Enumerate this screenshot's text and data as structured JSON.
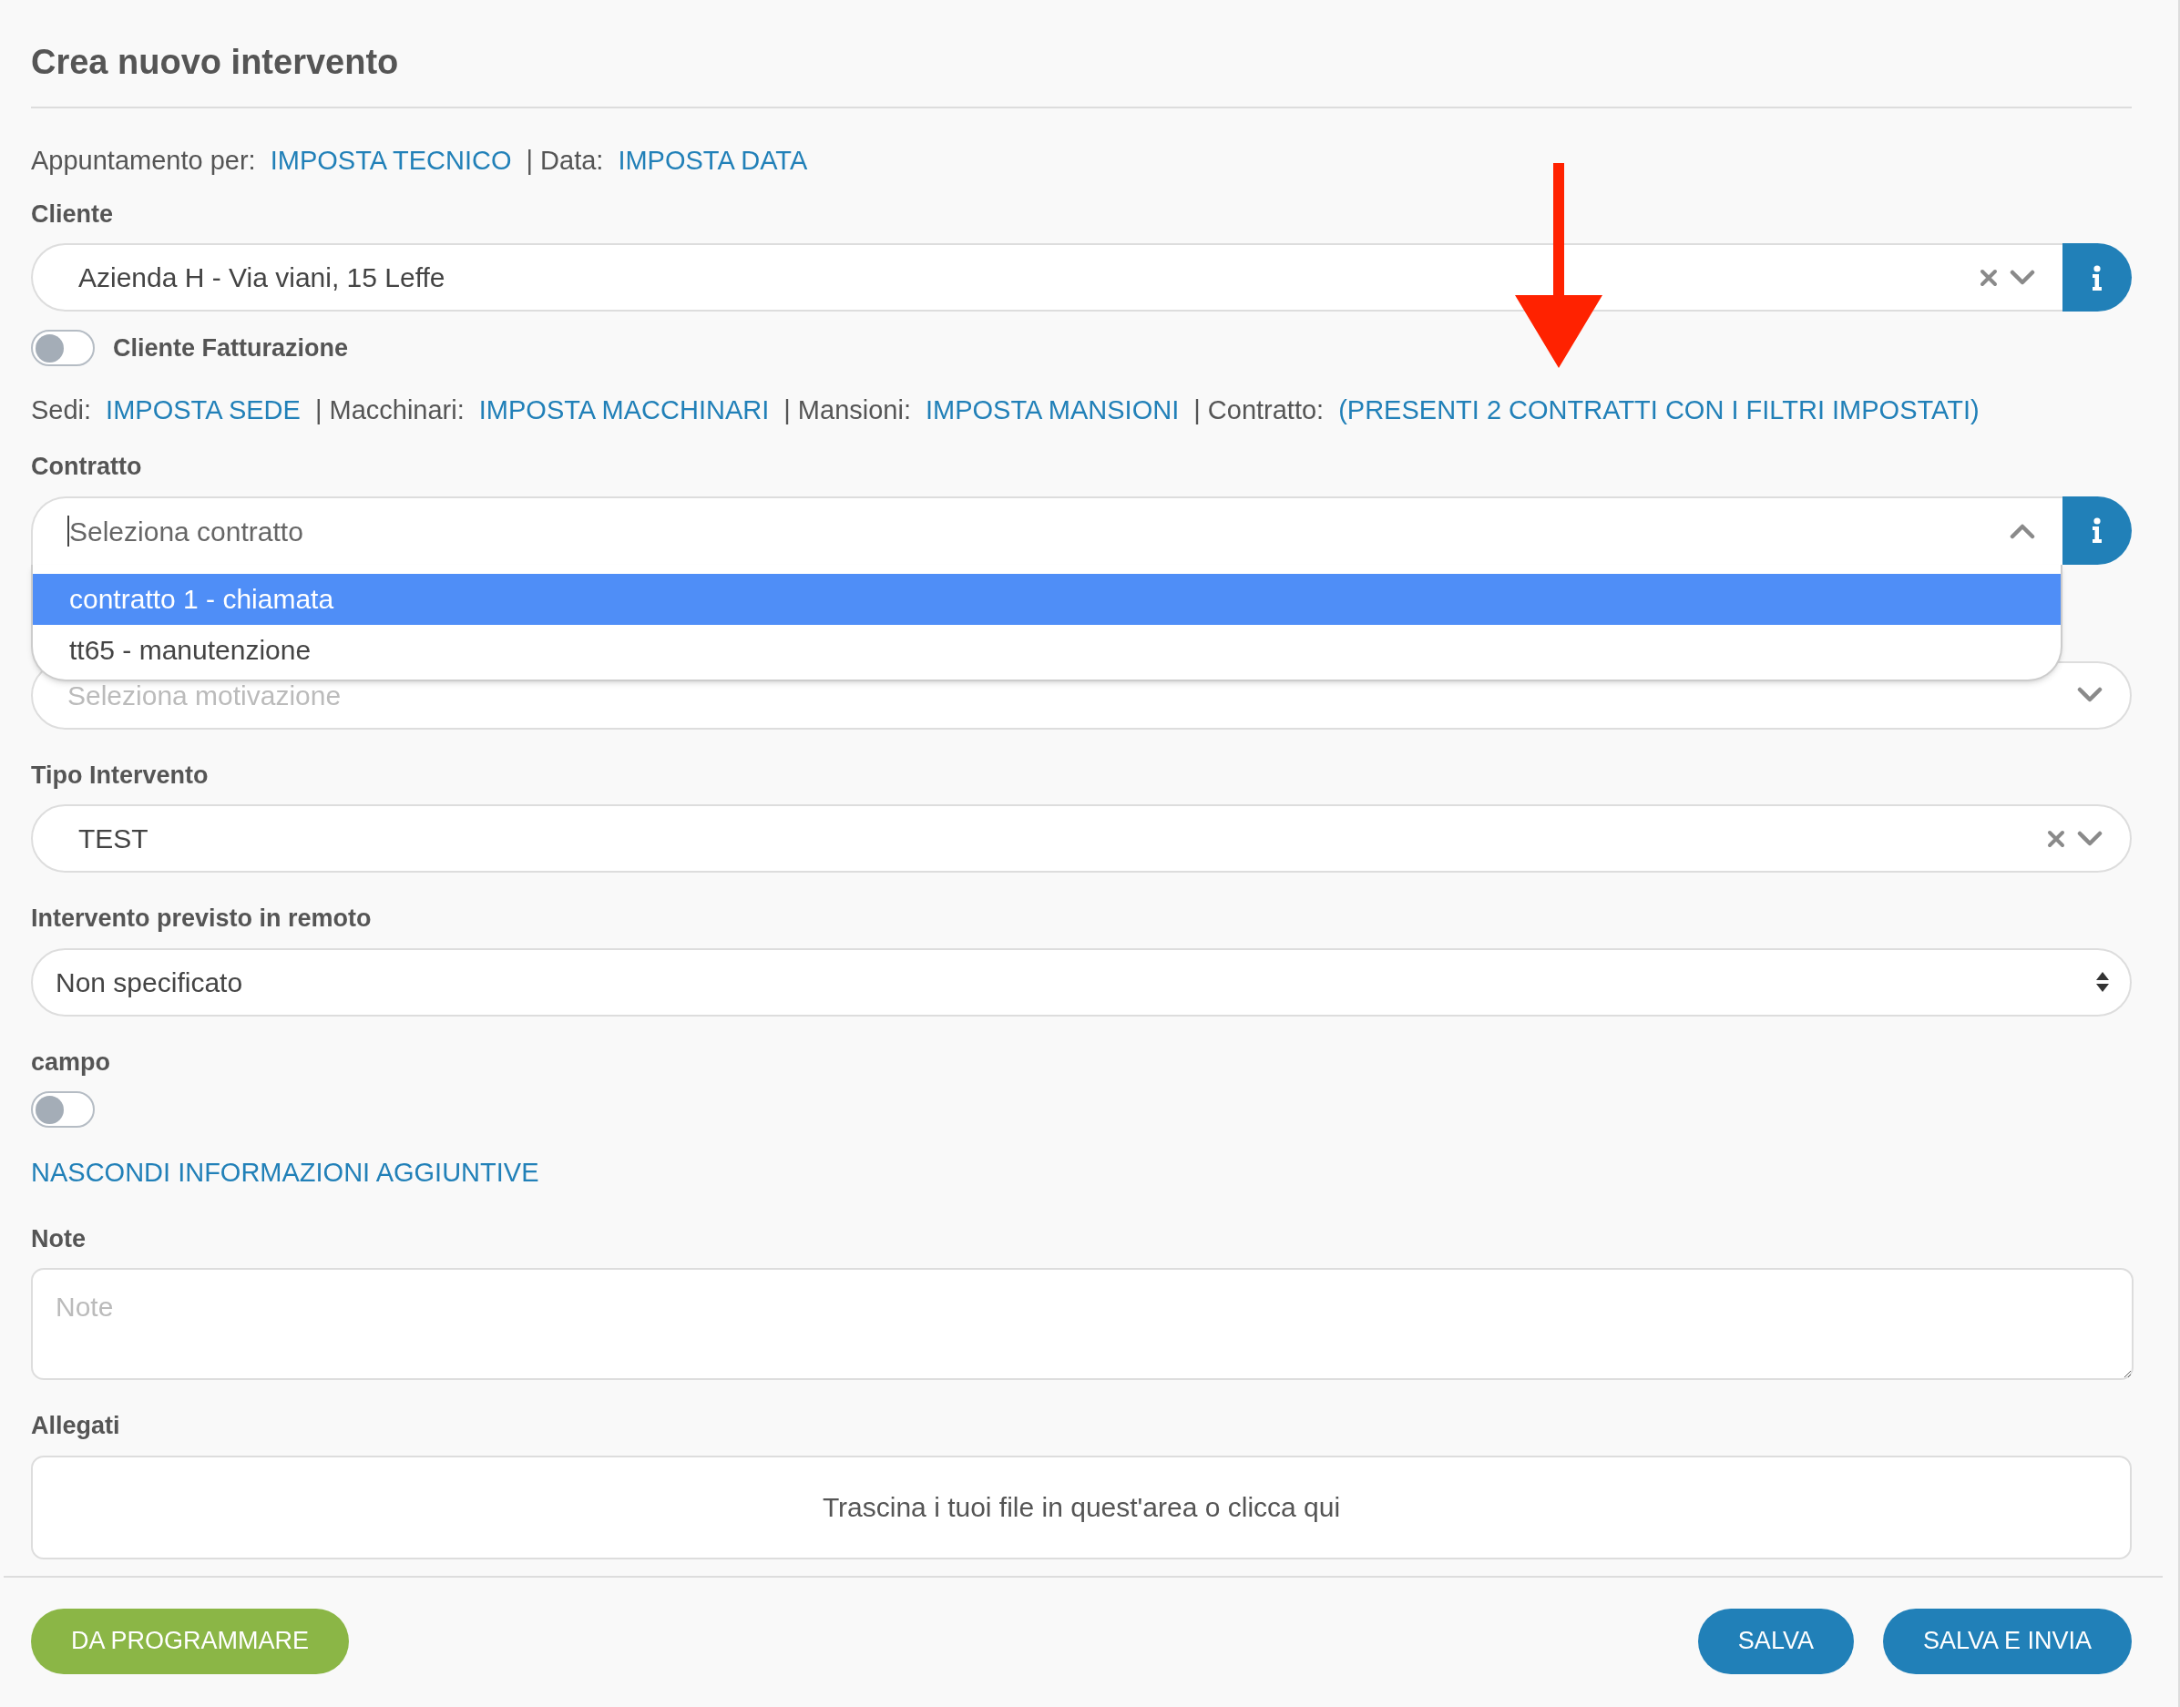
{
  "title": "Crea nuovo intervento",
  "info_row": [
    {
      "kind": "label",
      "text": "Appuntamento per:"
    },
    {
      "kind": "link",
      "text": "IMPOSTA TECNICO"
    },
    {
      "kind": "label",
      "text": "| Data:"
    },
    {
      "kind": "link",
      "text": "IMPOSTA DATA"
    }
  ],
  "cliente": {
    "label": "Cliente",
    "value": "Azienda H - Via viani, 15 Leffe"
  },
  "billing_toggle": {
    "label": "Cliente Fatturazione",
    "on": false
  },
  "links_row": [
    {
      "kind": "label",
      "text": "Sedi:"
    },
    {
      "kind": "link",
      "text": "IMPOSTA SEDE"
    },
    {
      "kind": "label",
      "text": "| Macchinari:"
    },
    {
      "kind": "link",
      "text": "IMPOSTA MACCHINARI"
    },
    {
      "kind": "label",
      "text": "| Mansioni:"
    },
    {
      "kind": "link",
      "text": "IMPOSTA MANSIONI"
    },
    {
      "kind": "label",
      "text": "| Contratto:"
    },
    {
      "kind": "link",
      "text": "(PRESENTI 2 CONTRATTI CON I FILTRI IMPOSTATI)"
    }
  ],
  "contratto": {
    "label": "Contratto",
    "placeholder": "Seleziona contratto",
    "expanded": true,
    "options": [
      {
        "text": "contratto 1 - chiamata",
        "selected": true
      },
      {
        "text": "tt65 - manutenzione",
        "selected": false
      }
    ]
  },
  "motivazione": {
    "placeholder": "Seleziona motivazione"
  },
  "tipo": {
    "label": "Tipo Intervento",
    "value": "TEST"
  },
  "remoto": {
    "label": "Intervento previsto in remoto",
    "value": "Non specificato"
  },
  "campo": {
    "label": "campo",
    "on": false
  },
  "toggle_link": "NASCONDI INFORMAZIONI AGGIUNTIVE",
  "note": {
    "label": "Note",
    "placeholder": "Note"
  },
  "allegati": {
    "label": "Allegati",
    "dropzone": "Trascina i tuoi file in quest'area o clicca qui"
  },
  "footer": {
    "left_button": "DA PROGRAMMARE",
    "right_buttons": [
      "SALVA",
      "SALVA E INVIA"
    ]
  }
}
